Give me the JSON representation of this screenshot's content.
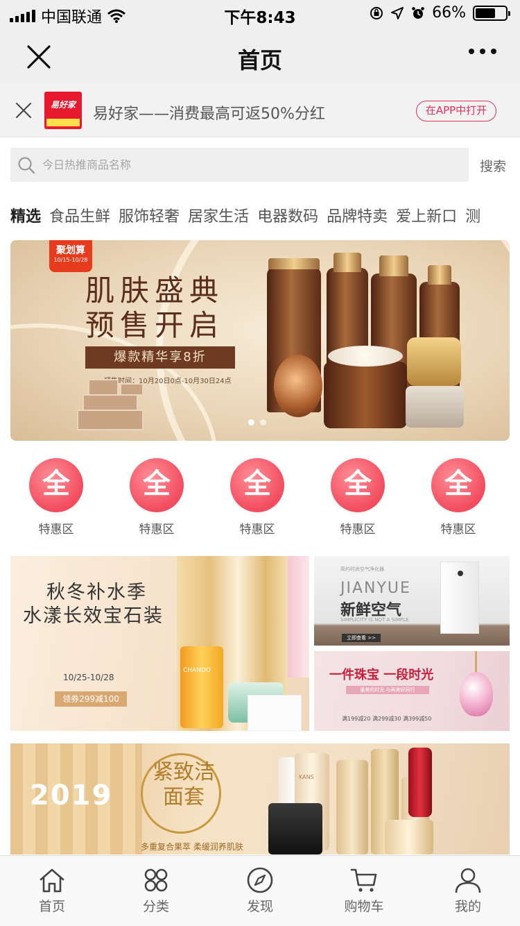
{
  "status_bar": {
    "carrier": "中国联通",
    "time": "下午8:43",
    "battery": "66%",
    "battery_level": 0.66
  },
  "nav": {
    "title": "首页"
  },
  "app_banner": {
    "text": "易好家——消费最高可返50%分红",
    "open_label": "在APP中打开",
    "logo_text": "易好家"
  },
  "search": {
    "placeholder": "今日热推商品名称",
    "button": "搜索"
  },
  "categories": [
    "精选",
    "食品生鲜",
    "服饰轻奢",
    "居家生活",
    "电器数码",
    "品牌特卖",
    "爱上新口",
    "测"
  ],
  "hero": {
    "tag_title": "聚划算",
    "tag_date": "10/15-10/28",
    "headline_1": "肌肤盛典",
    "headline_2": "预售开启",
    "subline": "爆款精华享8折",
    "presale": "预售时间：10月20日0点-10月30日24点"
  },
  "quick_entries": [
    {
      "icon": "全",
      "label": "特惠区"
    },
    {
      "icon": "全",
      "label": "特惠区"
    },
    {
      "icon": "全",
      "label": "特惠区"
    },
    {
      "icon": "全",
      "label": "特惠区"
    },
    {
      "icon": "全",
      "label": "特惠区"
    }
  ],
  "promo_a": {
    "line1": "秋冬补水季",
    "line2": "水漾长效宝石装",
    "date": "10/25-10/28",
    "coupon": "领券299减100",
    "brand": "CHANDO"
  },
  "promo_b": {
    "small": "简约时尚空气净化器",
    "en": "JIANYUE",
    "title": "新鲜空气",
    "sub": "SIMPLICITY IS NOT A SIMPLE",
    "btn": "立即查看 >>"
  },
  "promo_c": {
    "title": "一件珠宝 一段时光",
    "strip": "最美的时光 与再美好同行",
    "deals": "满199减20 满299减30 满399减50"
  },
  "promo_d": {
    "year": "2019",
    "title": "紧致洁面套",
    "sub": "多重复合果萃 柔缓润养肌肤",
    "brand": "KANS"
  },
  "tabbar": [
    {
      "label": "首页",
      "icon": "home-icon"
    },
    {
      "label": "分类",
      "icon": "category-icon"
    },
    {
      "label": "发现",
      "icon": "compass-icon"
    },
    {
      "label": "购物车",
      "icon": "cart-icon"
    },
    {
      "label": "我的",
      "icon": "user-icon"
    }
  ]
}
